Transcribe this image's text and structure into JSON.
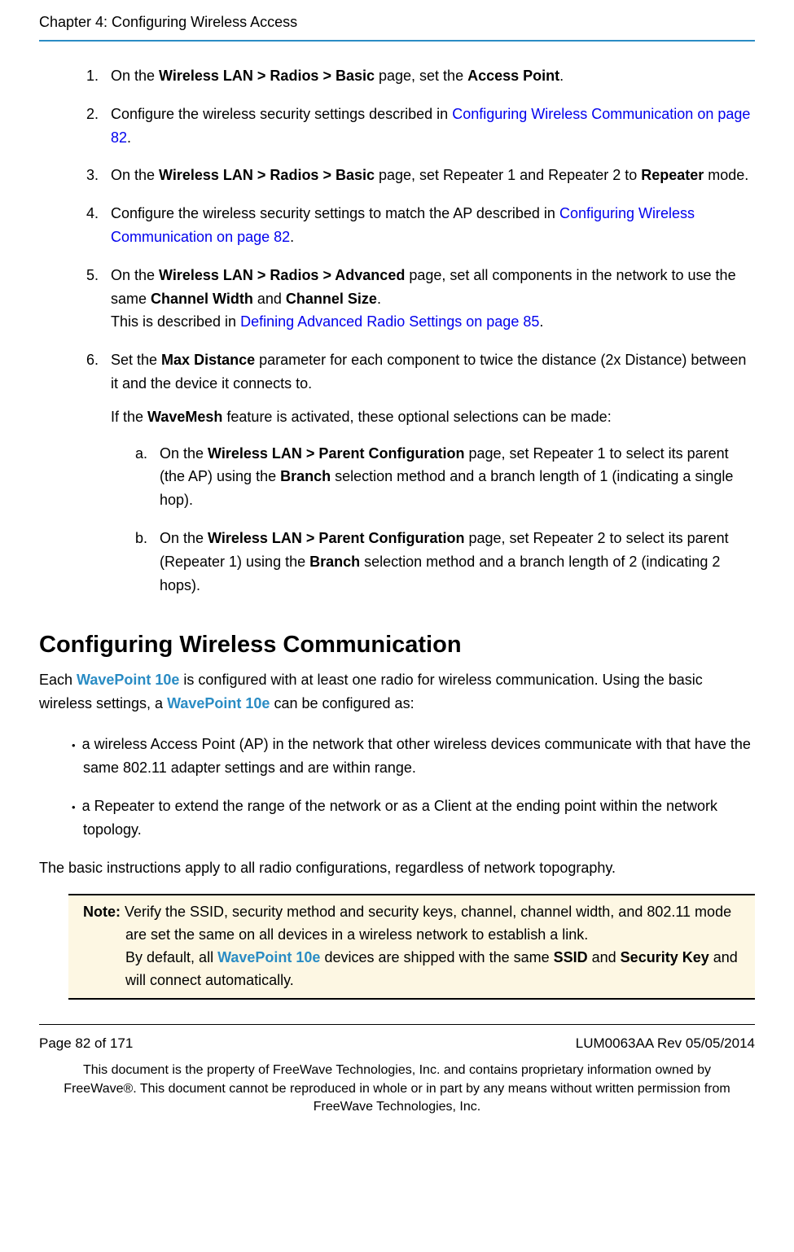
{
  "header": {
    "chapter": "Chapter 4: Configuring Wireless Access"
  },
  "steps": {
    "s1_a": "On the ",
    "s1_b": "Wireless LAN > Radios > Basic",
    "s1_c": " page, set the ",
    "s1_d": "Access Point",
    "s1_e": ".",
    "s2_a": "Configure the wireless security settings described in ",
    "s2_link": "Configuring Wireless Communication on page 82",
    "s2_b": ".",
    "s3_a": "On the ",
    "s3_b": "Wireless LAN > Radios > Basic",
    "s3_c": " page, set Repeater 1 and Repeater 2 to ",
    "s3_d": "Repeater",
    "s3_e": " mode.",
    "s4_a": "Configure the wireless security settings to match the AP described in ",
    "s4_link": "Configuring Wireless Communication on page 82",
    "s4_b": ".",
    "s5_a": "On the ",
    "s5_b": "Wireless LAN > Radios > Advanced",
    "s5_c": " page, set all components in the network to use the same ",
    "s5_d": "Channel Width",
    "s5_e": " and ",
    "s5_f": "Channel Size",
    "s5_g": ".",
    "s5_h": "This is described in ",
    "s5_link": "Defining Advanced Radio Settings on page 85",
    "s5_i": ".",
    "s6_a": "Set the ",
    "s6_b": "Max Distance",
    "s6_c": " parameter for each component to twice the distance (2x Distance) between it and the device it connects to.",
    "s6_if_a": "If the ",
    "s6_if_b": "WaveMesh",
    "s6_if_c": " feature is activated, these optional selections can be made:",
    "sa_a": "On the ",
    "sa_b": "Wireless LAN > Parent Configuration",
    "sa_c": " page, set Repeater 1 to select its parent (the AP) using the ",
    "sa_d": "Branch",
    "sa_e": " selection method and a branch length of 1 (indicating a single hop).",
    "sb_a": "On the ",
    "sb_b": "Wireless LAN > Parent Configuration",
    "sb_c": " page, set Repeater 2 to select its parent (Repeater 1) using the ",
    "sb_d": "Branch",
    "sb_e": " selection method and a branch length of 2 (indicating 2 hops)."
  },
  "section": {
    "heading": "Configuring Wireless Communication"
  },
  "intro": {
    "a": "Each ",
    "brand1": "WavePoint 10e",
    "b": " is configured with at least one radio for wireless communication. Using the basic wireless settings, a ",
    "brand2": "WavePoint 10e",
    "c": " can be configured as:"
  },
  "bullets": {
    "b1": "a wireless Access Point (AP) in the network that other wireless devices communicate with that have the same 802.11 adapter settings and are within range.",
    "b2": "a Repeater to extend the range of the network or as a Client at the ending point within the network topology."
  },
  "closing": "The basic instructions apply to all radio configurations, regardless of network topography.",
  "note": {
    "label": "Note: ",
    "line1": "Verify the SSID, security method and security keys, channel, channel width, and 802.11 mode are set the same on all devices in a wireless network to establish a link.",
    "line2a": "By default, all ",
    "brand": "WavePoint 10e",
    "line2b": " devices are shipped with the same ",
    "ssid": "SSID",
    "line2c": " and ",
    "seckey": "Security Key",
    "line2d": " and will connect automatically."
  },
  "footer": {
    "page": "Page 82 of 171",
    "rev": "LUM0063AA Rev 05/05/2014",
    "disclaimer": "This document is the property of FreeWave Technologies, Inc. and contains proprietary information owned by FreeWave®. This document cannot be reproduced in whole or in part by any means without written permission from FreeWave Technologies, Inc."
  }
}
